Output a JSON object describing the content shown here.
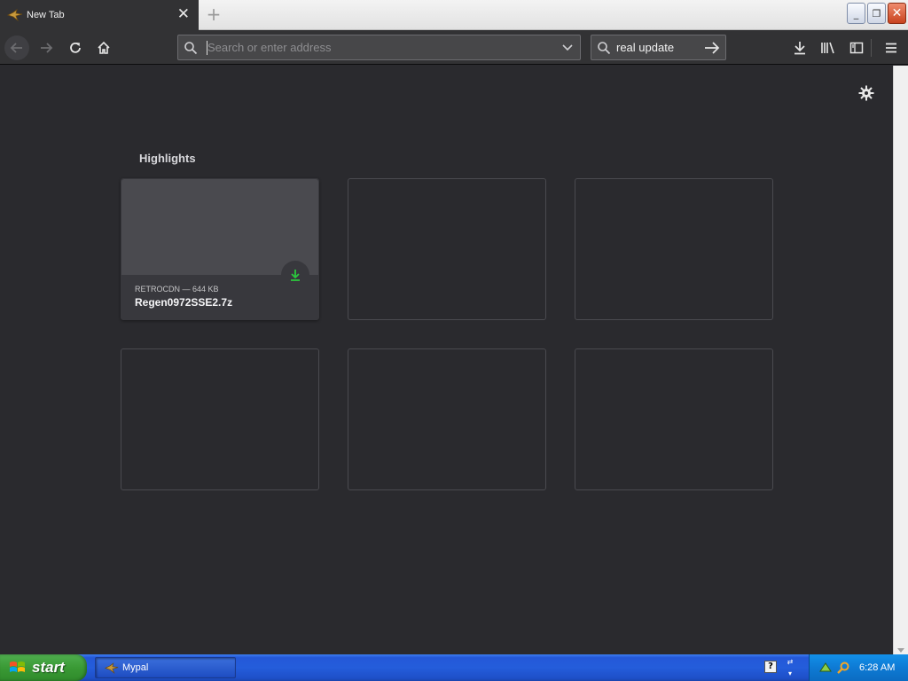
{
  "browser": {
    "tab": {
      "title": "New Tab",
      "close_label": "✕"
    },
    "new_tab_label": "+",
    "window_buttons": {
      "minimize": "_",
      "maximize": "❐",
      "close": "✕"
    }
  },
  "navbar": {
    "url_placeholder": "Search or enter address",
    "url_value": "",
    "search_query": "real update"
  },
  "content": {
    "highlights_title": "Highlights",
    "cards": [
      {
        "meta": "RETROCDN — 644 KB",
        "filename": "Regen0972SSE2.7z",
        "icon": "download-icon"
      }
    ]
  },
  "taskbar": {
    "start_label": "start",
    "task_label": "Mypal",
    "clock": "6:28 AM"
  },
  "colors": {
    "background": "#2a2a2e",
    "card": "#38383d",
    "download_green": "#2ac83d",
    "taskbar_blue": "#245ddb",
    "start_green": "#3a9a35"
  }
}
